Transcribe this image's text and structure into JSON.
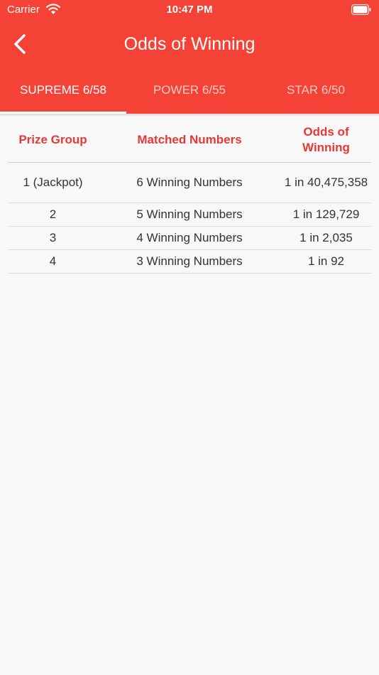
{
  "status_bar": {
    "carrier": "Carrier",
    "time": "10:47 PM"
  },
  "header": {
    "title": "Odds of Winning"
  },
  "tabs": [
    {
      "label": "SUPREME 6/58",
      "active": true
    },
    {
      "label": "POWER 6/55",
      "active": false
    },
    {
      "label": "STAR 6/50",
      "active": false
    }
  ],
  "table": {
    "columns": [
      "Prize Group",
      "Matched Numbers",
      "Odds of Winning"
    ],
    "rows": [
      [
        "1 (Jackpot)",
        "6 Winning Numbers",
        "1 in 40,475,358"
      ],
      [
        "2",
        "5 Winning Numbers",
        "1 in 129,729"
      ],
      [
        "3",
        "4 Winning Numbers",
        "1 in 2,035"
      ],
      [
        "4",
        "3 Winning Numbers",
        "1 in 92"
      ]
    ]
  },
  "colors": {
    "primary": "#f44336",
    "header_text": "#e53935",
    "background": "#f8f8f8"
  },
  "icons": [
    "wifi-icon",
    "battery-icon",
    "back-chevron-icon"
  ]
}
